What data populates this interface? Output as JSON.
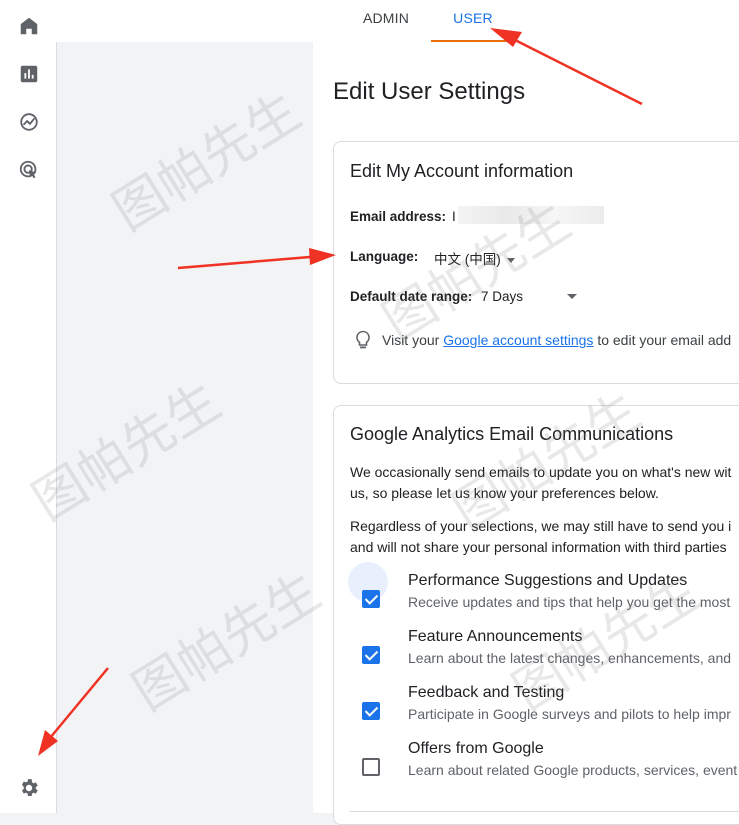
{
  "sidebar": {
    "items": [
      {
        "icon": "home-icon"
      },
      {
        "icon": "reports-icon"
      },
      {
        "icon": "explore-icon"
      },
      {
        "icon": "advertising-icon"
      }
    ],
    "settings_icon": "gear-icon"
  },
  "tabs": {
    "admin": "ADMIN",
    "user": "USER",
    "active": "USER"
  },
  "page": {
    "title": "Edit User Settings"
  },
  "account_card": {
    "title": "Edit My Account information",
    "email_label": "Email address:",
    "email_value": "I",
    "language_label": "Language:",
    "language_value": "中文 (中国)",
    "date_range_label": "Default date range:",
    "date_range_value": "7 Days",
    "hint_prefix": "Visit your ",
    "hint_link": "Google account settings",
    "hint_suffix": " to edit your email add"
  },
  "email_card": {
    "title": "Google Analytics Email Communications",
    "intro_line1": "We occasionally send emails to update you on what's new wit",
    "intro_line2": "us, so please let us know your preferences below.",
    "notice_line1": "Regardless of your selections, we may still have to send you i",
    "notice_line2": "and will not share your personal information with third parties",
    "options": [
      {
        "title": "Performance Suggestions and Updates",
        "desc": "Receive updates and tips that help you get the most",
        "checked": true
      },
      {
        "title": "Feature Announcements",
        "desc": "Learn about the latest changes, enhancements, and",
        "checked": true
      },
      {
        "title": "Feedback and Testing",
        "desc": "Participate in Google surveys and pilots to help impr",
        "checked": true
      },
      {
        "title": "Offers from Google",
        "desc": "Learn about related Google products, services, event",
        "checked": false
      }
    ]
  },
  "watermark": "图帕先生",
  "colors": {
    "accent": "#1a73e8",
    "tab_underline": "#e8710a",
    "annotation_arrow": "#f03224"
  }
}
